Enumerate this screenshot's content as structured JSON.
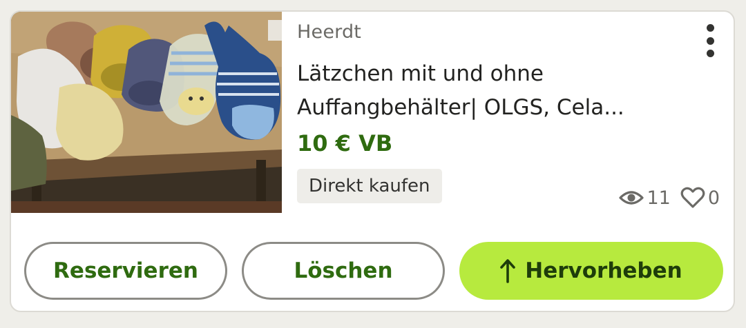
{
  "listing": {
    "location": "Heerdt",
    "title_line1": "Lätzchen mit und ohne",
    "title_line2": "Auffangbehälter| OLGS, Cela...",
    "price": "10 € VB",
    "badge": "Direkt kaufen",
    "views": "11",
    "likes": "0"
  },
  "icons": {
    "menu": "more-vertical-icon",
    "views": "eye-icon",
    "likes": "heart-icon",
    "highlight": "arrow-up-icon"
  },
  "actions": {
    "reserve_label": "Reservieren",
    "delete_label": "Löschen",
    "highlight_label": "Hervorheben"
  },
  "colors": {
    "price": "#2f6b10",
    "highlight_bg": "#b7ea3e",
    "button_text": "#2f6b10",
    "muted_text": "#6b6a66"
  }
}
